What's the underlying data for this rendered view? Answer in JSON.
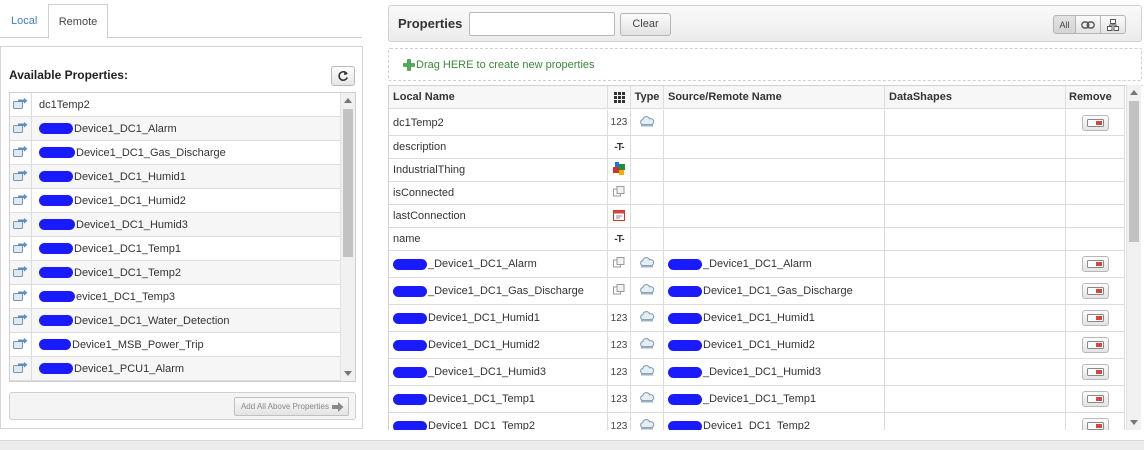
{
  "tabs": {
    "local": "Local",
    "remote": "Remote"
  },
  "left": {
    "title": "Available Properties:",
    "refresh_icon": "refresh-icon",
    "items": [
      {
        "prefix_redacted": false,
        "text": "dc1Temp2"
      },
      {
        "prefix_redacted": true,
        "text": "Device1_DC1_Alarm"
      },
      {
        "prefix_redacted": true,
        "text": "Device1_DC1_Gas_Discharge"
      },
      {
        "prefix_redacted": true,
        "text": "Device1_DC1_Humid1"
      },
      {
        "prefix_redacted": true,
        "text": "Device1_DC1_Humid2"
      },
      {
        "prefix_redacted": true,
        "text": "Device1_DC1_Humid3"
      },
      {
        "prefix_redacted": true,
        "text": "Device1_DC1_Temp1"
      },
      {
        "prefix_redacted": true,
        "text": "Device1_DC1_Temp2"
      },
      {
        "prefix_redacted": true,
        "text": "evice1_DC1_Temp3"
      },
      {
        "prefix_redacted": true,
        "text": "Device1_DC1_Water_Detection"
      },
      {
        "prefix_redacted": true,
        "text": "Device1_MSB_Power_Trip"
      },
      {
        "prefix_redacted": true,
        "text": "Device1_PCU1_Alarm"
      }
    ],
    "add_all_label": "Add All Above Properties"
  },
  "properties": {
    "title": "Properties",
    "search_value": "",
    "clear_label": "Clear",
    "filter_all": "All",
    "drag_hint": "Drag HERE to create new properties"
  },
  "grid": {
    "headers": {
      "local_name": "Local Name",
      "type": "Type",
      "source": "Source/Remote Name",
      "datashapes": "DataShapes",
      "remove": "Remove"
    },
    "rows": [
      {
        "name": "dc1Temp2",
        "name_redacted": false,
        "base": "123",
        "type": "cloud",
        "src": "",
        "src_redacted": false,
        "remove": true
      },
      {
        "name": "description",
        "name_redacted": false,
        "base": "-T-",
        "type": "",
        "src": "",
        "src_redacted": false,
        "remove": false
      },
      {
        "name": "IndustrialThing",
        "name_redacted": false,
        "base": "thing",
        "type": "",
        "src": "",
        "src_redacted": false,
        "remove": false
      },
      {
        "name": "isConnected",
        "name_redacted": false,
        "base": "bool",
        "type": "",
        "src": "",
        "src_redacted": false,
        "remove": false
      },
      {
        "name": "lastConnection",
        "name_redacted": false,
        "base": "date",
        "type": "",
        "src": "",
        "src_redacted": false,
        "remove": false
      },
      {
        "name": "name",
        "name_redacted": false,
        "base": "-T-",
        "type": "",
        "src": "",
        "src_redacted": false,
        "remove": false
      },
      {
        "name": "_Device1_DC1_Alarm",
        "name_redacted": true,
        "base": "bool",
        "type": "cloud",
        "src": "_Device1_DC1_Alarm",
        "src_redacted": true,
        "remove": true
      },
      {
        "name": "_Device1_DC1_Gas_Discharge",
        "name_redacted": true,
        "base": "bool",
        "type": "cloud",
        "src": "Device1_DC1_Gas_Discharge",
        "src_redacted": true,
        "remove": true
      },
      {
        "name": "Device1_DC1_Humid1",
        "name_redacted": true,
        "base": "123",
        "type": "cloud",
        "src": "Device1_DC1_Humid1",
        "src_redacted": true,
        "remove": true
      },
      {
        "name": "Device1_DC1_Humid2",
        "name_redacted": true,
        "base": "123",
        "type": "cloud",
        "src": "Device1_DC1_Humid2",
        "src_redacted": true,
        "remove": true
      },
      {
        "name": "_Device1_DC1_Humid3",
        "name_redacted": true,
        "base": "123",
        "type": "cloud",
        "src": "_Device1_DC1_Humid3",
        "src_redacted": true,
        "remove": true
      },
      {
        "name": "Device1_DC1_Temp1",
        "name_redacted": true,
        "base": "123",
        "type": "cloud",
        "src": "_Device1_DC1_Temp1",
        "src_redacted": true,
        "remove": true
      },
      {
        "name": "Device1_DC1_Temp2",
        "name_redacted": true,
        "base": "123",
        "type": "cloud",
        "src": "Device1_DC1_Temp2",
        "src_redacted": true,
        "remove": true
      }
    ]
  }
}
